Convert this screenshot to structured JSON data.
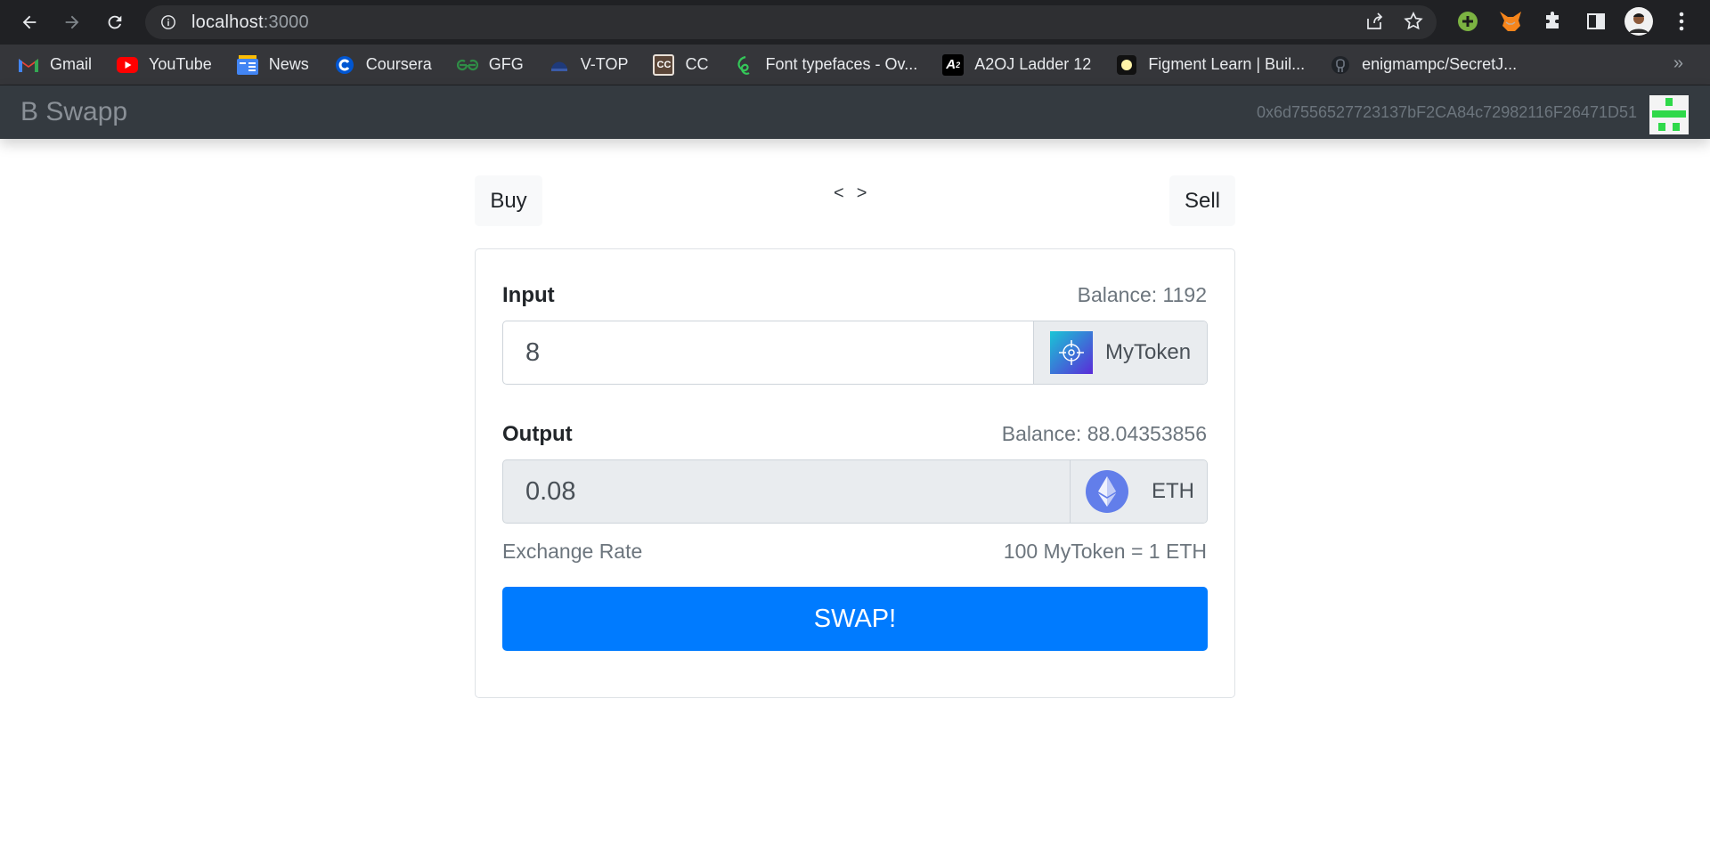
{
  "browser": {
    "url_host": "localhost",
    "url_port": ":3000",
    "bookmarks": [
      {
        "label": "Gmail",
        "icon": "gmail-icon"
      },
      {
        "label": "YouTube",
        "icon": "youtube-icon"
      },
      {
        "label": "News",
        "icon": "google-news-icon"
      },
      {
        "label": "Coursera",
        "icon": "coursera-icon"
      },
      {
        "label": "GFG",
        "icon": "gfg-icon"
      },
      {
        "label": "V-TOP",
        "icon": "vtop-icon"
      },
      {
        "label": "CC",
        "icon": "codechef-icon"
      },
      {
        "label": "Font typefaces - Ov...",
        "icon": "font-icon"
      },
      {
        "label": "A2OJ Ladder 12",
        "icon": "a2oj-icon"
      },
      {
        "label": "Figment Learn | Buil...",
        "icon": "figment-icon"
      },
      {
        "label": "enigmampc/SecretJ...",
        "icon": "github-icon"
      }
    ],
    "bookmarks_more": "»"
  },
  "navbar": {
    "brand": "B Swapp",
    "account": "0x6d7556527723137bF2CA84c72982116F26471D51"
  },
  "controls": {
    "buy_label": "Buy",
    "sell_label": "Sell",
    "prev": "<",
    "next": ">"
  },
  "form": {
    "input_label": "Input",
    "input_balance": "Balance: 1192",
    "input_value": "8",
    "input_token": "MyToken",
    "output_label": "Output",
    "output_balance": "Balance: 88.04353856",
    "output_value": "0.08",
    "output_token": "ETH",
    "rate_label": "Exchange Rate",
    "rate_value": "100 MyToken = 1 ETH",
    "swap_label": "SWAP!"
  },
  "colors": {
    "primary": "#007bff",
    "navbar_bg": "#343a40",
    "chrome_bg": "#202124"
  }
}
